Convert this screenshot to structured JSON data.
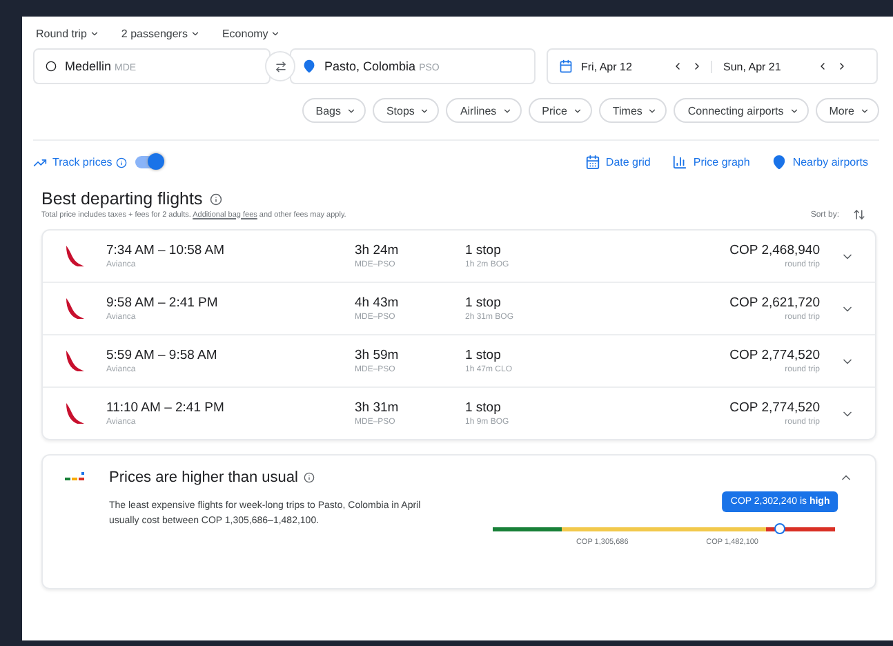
{
  "trip_options": [
    {
      "label": "Round trip"
    },
    {
      "label": "2 passengers"
    },
    {
      "label": "Economy"
    }
  ],
  "origin": {
    "city": "Medellin",
    "code": "MDE"
  },
  "destination": {
    "city": "Pasto, Colombia",
    "code": "PSO"
  },
  "depart_date": "Fri, Apr 12",
  "return_date": "Sun, Apr 21",
  "filters": [
    "Bags",
    "Stops",
    "Airlines",
    "Price",
    "Times",
    "Connecting airports",
    "More"
  ],
  "track_prices": {
    "label": "Track prices",
    "on": true
  },
  "tools": [
    {
      "kind": "grid",
      "label": "Date grid"
    },
    {
      "kind": "graph",
      "label": "Price graph"
    },
    {
      "kind": "pin",
      "label": "Nearby airports"
    }
  ],
  "heading": "Best departing flights",
  "note_parts": [
    "Total price includes taxes + fees for 2 adults. ",
    "Additional bag fees",
    " and other fees may apply."
  ],
  "sort_label": "Sort by:",
  "flights": [
    {
      "times": "7:34 AM – 10:58 AM",
      "airline": "Avianca",
      "duration": "3h 24m",
      "route": "MDE–PSO",
      "stops": "1 stop",
      "layover": "1h 2m BOG",
      "price": "COP 2,468,940",
      "price_note": "round trip"
    },
    {
      "times": "9:58 AM – 2:41 PM",
      "airline": "Avianca",
      "duration": "4h 43m",
      "route": "MDE–PSO",
      "stops": "1 stop",
      "layover": "2h 31m BOG",
      "price": "COP 2,621,720",
      "price_note": "round trip"
    },
    {
      "times": "5:59 AM – 9:58 AM",
      "airline": "Avianca",
      "duration": "3h 59m",
      "route": "MDE–PSO",
      "stops": "1 stop",
      "layover": "1h 47m CLO",
      "price": "COP 2,774,520",
      "price_note": "round trip"
    },
    {
      "times": "11:10 AM – 2:41 PM",
      "airline": "Avianca",
      "duration": "3h 31m",
      "route": "MDE–PSO",
      "stops": "1 stop",
      "layover": "1h 9m BOG",
      "price": "COP 2,774,520",
      "price_note": "round trip"
    }
  ],
  "insight": {
    "title": "Prices are higher than usual",
    "text": "The least expensive flights for week-long trips to Pasto, Colombia in April usually cost between COP 1,305,686–1,482,100.",
    "tooltip": "COP 2,302,240 is **high**",
    "level": 0.84,
    "low_label": "COP 1,305,686",
    "high_label": "COP 1,482,100"
  }
}
